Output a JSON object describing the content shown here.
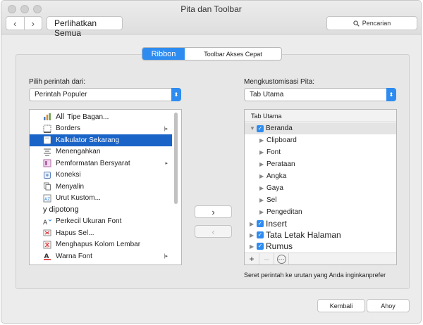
{
  "window": {
    "title": "Pita dan Toolbar"
  },
  "toolbar": {
    "back_label": "‹",
    "forward_label": "›",
    "show_all_label": "Perlihatkan Semua",
    "search_label": "Pencarian"
  },
  "tabs": [
    {
      "label": "Ribbon",
      "active": true
    },
    {
      "label": "Toolbar Akses Cepat",
      "active": false
    }
  ],
  "left": {
    "label": "Pilih perintah dari:",
    "dropdown_value": "Perintah Populer",
    "commands": [
      {
        "label": "Tipe Bagan...",
        "prefix": "All",
        "icon": "chart-icon",
        "submenu": "",
        "selected": false
      },
      {
        "label": "Borders",
        "prefix": "",
        "icon": "borders-icon",
        "submenu": "|▸",
        "selected": false
      },
      {
        "label": "Kalkulator Sekarang",
        "prefix": "",
        "icon": "calculator-icon",
        "submenu": "",
        "selected": true
      },
      {
        "label": "Menengahkan",
        "prefix": "",
        "icon": "align-center-icon",
        "submenu": "",
        "selected": false
      },
      {
        "label": "Pemformatan Bersyarat",
        "prefix": "",
        "icon": "conditional-format-icon",
        "submenu": "▸",
        "selected": false
      },
      {
        "label": "Koneksi",
        "prefix": "",
        "icon": "connections-icon",
        "submenu": "",
        "selected": false
      },
      {
        "label": "Menyalin",
        "prefix": "",
        "icon": "copy-icon",
        "submenu": "",
        "selected": false
      },
      {
        "label": "Urut Kustom...",
        "prefix": "",
        "icon": "custom-sort-icon",
        "submenu": "",
        "selected": false
      },
      {
        "label": "y dipotong",
        "prefix": "",
        "icon": "",
        "submenu": "",
        "selected": false
      },
      {
        "label": "Perkecil Ukuran Font",
        "prefix": "",
        "icon": "decrease-font-icon",
        "submenu": "",
        "selected": false
      },
      {
        "label": "Hapus Sel...",
        "prefix": "",
        "icon": "delete-cells-icon",
        "submenu": "",
        "selected": false
      },
      {
        "label": "Menghapus Kolom Lembar",
        "prefix": "",
        "icon": "delete-column-icon",
        "submenu": "",
        "selected": false
      },
      {
        "label": "Warna Font",
        "prefix": "",
        "icon": "font-color-icon",
        "submenu": "|▸",
        "selected": false
      }
    ],
    "add_label": "›",
    "remove_label": "‹"
  },
  "right": {
    "label": "Mengkustomisasi Pita:",
    "dropdown_value": "Tab Utama",
    "tree_header": "Tab Utama",
    "items": [
      {
        "label": "Beranda",
        "level": 0,
        "expanded": true,
        "checked": true,
        "highlight": true,
        "big": false
      },
      {
        "label": "Clipboard",
        "level": 1,
        "expanded": false,
        "checked": false,
        "highlight": false,
        "big": false
      },
      {
        "label": "Font",
        "level": 1,
        "expanded": false,
        "checked": false,
        "highlight": false,
        "big": false
      },
      {
        "label": "Perataan",
        "level": 1,
        "expanded": false,
        "checked": false,
        "highlight": false,
        "big": false
      },
      {
        "label": "Angka",
        "level": 1,
        "expanded": false,
        "checked": false,
        "highlight": false,
        "big": false
      },
      {
        "label": "Gaya",
        "level": 1,
        "expanded": false,
        "checked": false,
        "highlight": false,
        "big": false
      },
      {
        "label": "Sel",
        "level": 1,
        "expanded": false,
        "checked": false,
        "highlight": false,
        "big": false
      },
      {
        "label": "Pengeditan",
        "level": 1,
        "expanded": false,
        "checked": false,
        "highlight": false,
        "big": false
      },
      {
        "label": "Insert",
        "level": 0,
        "expanded": false,
        "checked": true,
        "highlight": false,
        "big": true
      },
      {
        "label": "Tata Letak Halaman",
        "level": 0,
        "expanded": false,
        "checked": true,
        "highlight": false,
        "big": true
      },
      {
        "label": "Rumus",
        "level": 0,
        "expanded": false,
        "checked": true,
        "highlight": false,
        "big": true
      }
    ],
    "toolbar": {
      "add": "+",
      "remove": "–",
      "more": "⋯"
    },
    "hint": "Seret perintah ke urutan yang Anda inginkan",
    "hint_suffix": "prefer"
  },
  "footer": {
    "revert_label": "Kembali",
    "save_label": "Ahoy"
  },
  "colors": {
    "accent": "#2e8cf0",
    "selection": "#1a64c8"
  }
}
